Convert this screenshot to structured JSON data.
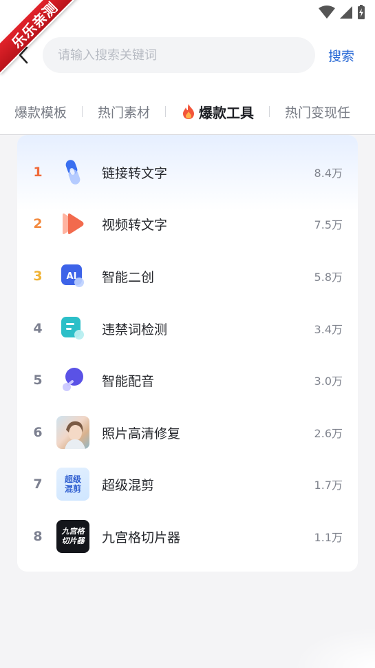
{
  "watermark": {
    "text": "乐乐亲测"
  },
  "search": {
    "placeholder": "请输入搜索关键词",
    "button_label": "搜索"
  },
  "tabs": [
    {
      "label": "爆款模板",
      "active": false
    },
    {
      "label": "热门素材",
      "active": false
    },
    {
      "label": "爆款工具",
      "active": true
    },
    {
      "label": "热门变现任",
      "active": false
    }
  ],
  "ranking": [
    {
      "rank": "1",
      "name": "链接转文字",
      "count": "8.4万",
      "icon": "link-icon"
    },
    {
      "rank": "2",
      "name": "视频转文字",
      "count": "7.5万",
      "icon": "video-play-icon"
    },
    {
      "rank": "3",
      "name": "智能二创",
      "count": "5.8万",
      "icon": "ai-icon",
      "icon_text": "AI"
    },
    {
      "rank": "4",
      "name": "违禁词检测",
      "count": "3.4万",
      "icon": "document-check-icon"
    },
    {
      "rank": "5",
      "name": "智能配音",
      "count": "3.0万",
      "icon": "voice-icon"
    },
    {
      "rank": "6",
      "name": "照片高清修复",
      "count": "2.6万",
      "icon": "photo-thumbnail"
    },
    {
      "rank": "7",
      "name": "超级混剪",
      "count": "1.7万",
      "icon": "super-mix-thumbnail",
      "icon_text": [
        "超级",
        "混剪"
      ]
    },
    {
      "rank": "8",
      "name": "九宫格切片器",
      "count": "1.1万",
      "icon": "grid-cutter-thumbnail",
      "icon_text": [
        "九宫格",
        "切片器"
      ]
    }
  ],
  "colors": {
    "accent": "#2b6bd6",
    "rank1": "#f06a3a",
    "rank2": "#f38a3f",
    "rank3": "#f0b234",
    "rank_default": "#7c8090"
  }
}
